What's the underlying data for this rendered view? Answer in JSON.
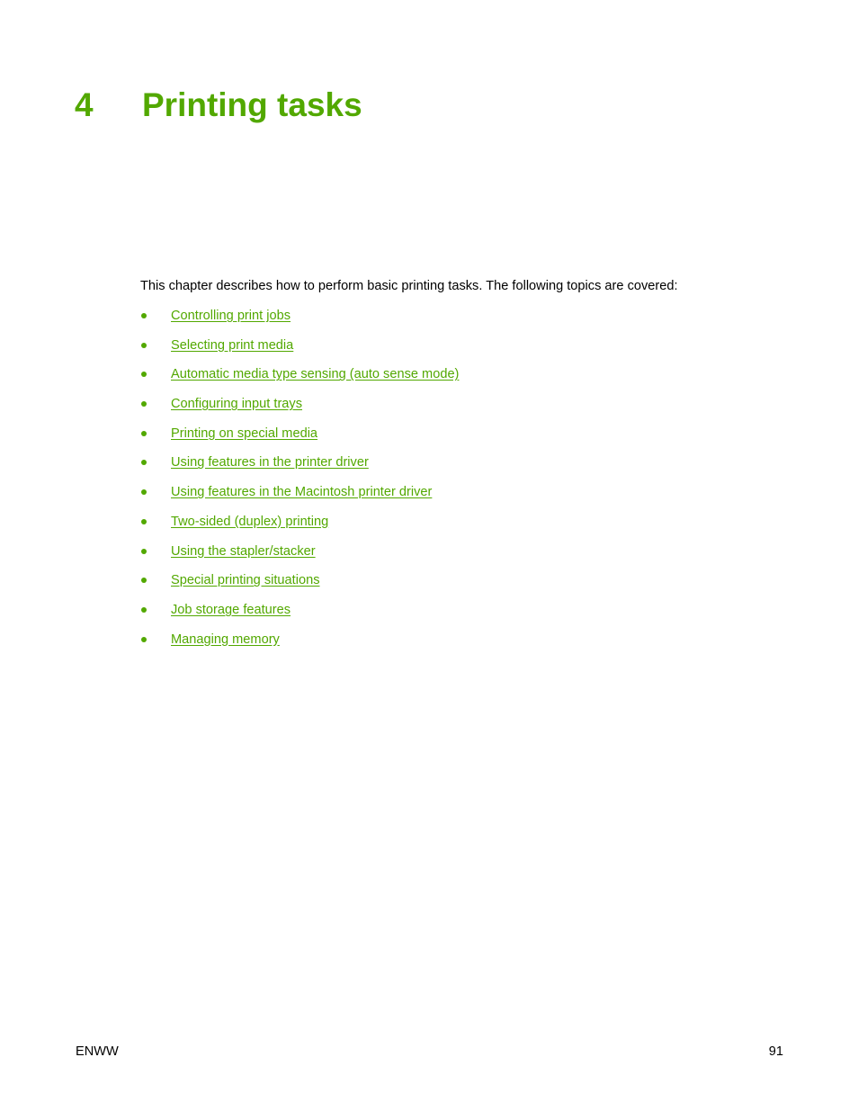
{
  "chapter": {
    "number": "4",
    "title": "Printing tasks"
  },
  "intro": "This chapter describes how to perform basic printing tasks. The following topics are covered:",
  "topics": [
    {
      "label": "Controlling print jobs"
    },
    {
      "label": "Selecting print media"
    },
    {
      "label": "Automatic media type sensing (auto sense mode)"
    },
    {
      "label": "Configuring input trays"
    },
    {
      "label": "Printing on special media"
    },
    {
      "label": "Using features in the printer driver"
    },
    {
      "label": "Using features in the Macintosh printer driver"
    },
    {
      "label": "Two-sided (duplex) printing"
    },
    {
      "label": "Using the stapler/stacker"
    },
    {
      "label": "Special printing situations"
    },
    {
      "label": "Job storage features"
    },
    {
      "label": "Managing memory"
    }
  ],
  "footer": {
    "left": "ENWW",
    "page_number": "91"
  },
  "colors": {
    "accent": "#52a800",
    "text": "#000000"
  }
}
